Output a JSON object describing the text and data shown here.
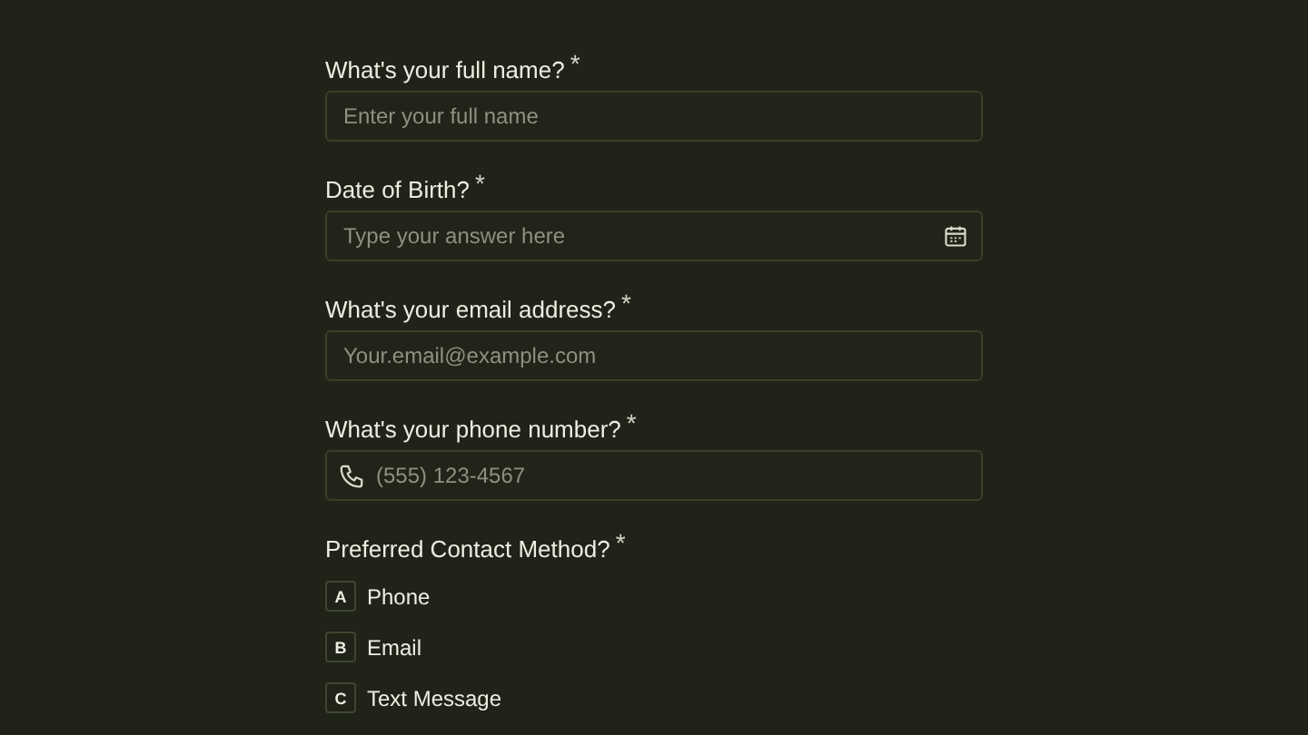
{
  "questions": [
    {
      "label": "What's your full name?",
      "required_mark": "*",
      "kind": "text",
      "placeholder": "Enter your full name"
    },
    {
      "label": "Date of Birth?",
      "required_mark": "*",
      "kind": "date",
      "placeholder": "Type your answer here"
    },
    {
      "label": "What's your email address?",
      "required_mark": "*",
      "kind": "text",
      "placeholder": "Your.email@example.com"
    },
    {
      "label": "What's your phone number?",
      "required_mark": "*",
      "kind": "phone",
      "placeholder": "(555) 123-4567"
    },
    {
      "label": "Preferred Contact Method?",
      "required_mark": "*",
      "kind": "choice",
      "options": [
        {
          "key": "A",
          "label": "Phone",
          "selected": false
        },
        {
          "key": "B",
          "label": "Email",
          "selected": false
        },
        {
          "key": "C",
          "label": "Text Message",
          "selected": false
        }
      ]
    }
  ]
}
